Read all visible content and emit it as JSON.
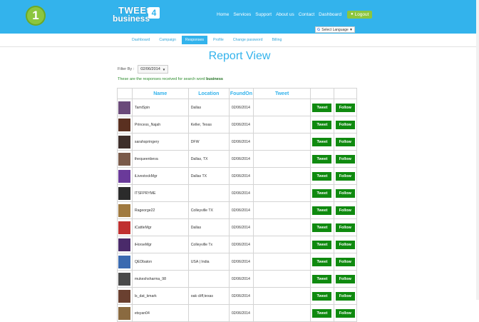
{
  "app": {
    "badge_number": "1",
    "logo_line1": "TWEEt",
    "logo_line2": "business",
    "logo_number": "4"
  },
  "topnav": {
    "items": [
      "Home",
      "Services",
      "Support",
      "About us",
      "Contact",
      "Dashboard"
    ],
    "logout_label": "Logout"
  },
  "language": {
    "label": "Select Language",
    "icon": "google-g-icon"
  },
  "subnav": {
    "tabs": [
      "Dashboard",
      "Campaign",
      "Responses",
      "Profile",
      "Change password",
      "Billing"
    ],
    "active": "Responses"
  },
  "page": {
    "title": "Report View",
    "filter_label": "Filter By :",
    "filter_value": "02/06/2014",
    "note_prefix": "These are the responses received for search word",
    "search_word": "business"
  },
  "table": {
    "headers": [
      "",
      "Name",
      "Location",
      "FoundOn",
      "Tweet",
      "",
      ""
    ],
    "tweet_button": "Tweet",
    "follow_button": "Follow",
    "rows": [
      {
        "name": "TamiSpin",
        "location": "Dallas",
        "found_on": "02/06/2014",
        "tweet": "",
        "avatar_color": "#6b4a7a"
      },
      {
        "name": "Princess_Najah",
        "location": "Keller, Texas",
        "found_on": "02/06/2014",
        "tweet": "",
        "avatar_color": "#5a3020"
      },
      {
        "name": "sarahspringery",
        "location": "DFW",
        "found_on": "02/06/2014",
        "tweet": "",
        "avatar_color": "#3d2e2a"
      },
      {
        "name": "thequeenbeva",
        "location": "Dallas, TX",
        "found_on": "02/06/2014",
        "tweet": "",
        "avatar_color": "#7a5a4a"
      },
      {
        "name": "iLivestockMgr",
        "location": "Dallas TX",
        "found_on": "02/06/2014",
        "tweet": "",
        "avatar_color": "#6a3a9a"
      },
      {
        "name": "ITSFPRYME",
        "location": "",
        "found_on": "02/06/2014",
        "tweet": "",
        "avatar_color": "#2b2b2b"
      },
      {
        "name": "Rageorge22",
        "location": "Colleyville TX",
        "found_on": "02/06/2014",
        "tweet": "",
        "avatar_color": "#a07a40"
      },
      {
        "name": "iCattleMgr",
        "location": "Dallas",
        "found_on": "02/06/2014",
        "tweet": "",
        "avatar_color": "#c03030"
      },
      {
        "name": "iHorseMgr",
        "location": "Colleyville Tx",
        "found_on": "02/06/2014",
        "tweet": "",
        "avatar_color": "#4a2a6a"
      },
      {
        "name": "QEDbaton",
        "location": "USA | India",
        "found_on": "02/06/2014",
        "tweet": "",
        "avatar_color": "#3a6ab0"
      },
      {
        "name": "mukeshsharma_98",
        "location": "",
        "found_on": "02/06/2014",
        "tweet": "",
        "avatar_color": "#4a4a4a"
      },
      {
        "name": "ls_dat_kmark",
        "location": "oak cliff,texas",
        "found_on": "02/06/2014",
        "tweet": "",
        "avatar_color": "#6a4030"
      },
      {
        "name": "etsyan04",
        "location": "",
        "found_on": "02/06/2014",
        "tweet": "",
        "avatar_color": "#8a6a40"
      }
    ]
  }
}
